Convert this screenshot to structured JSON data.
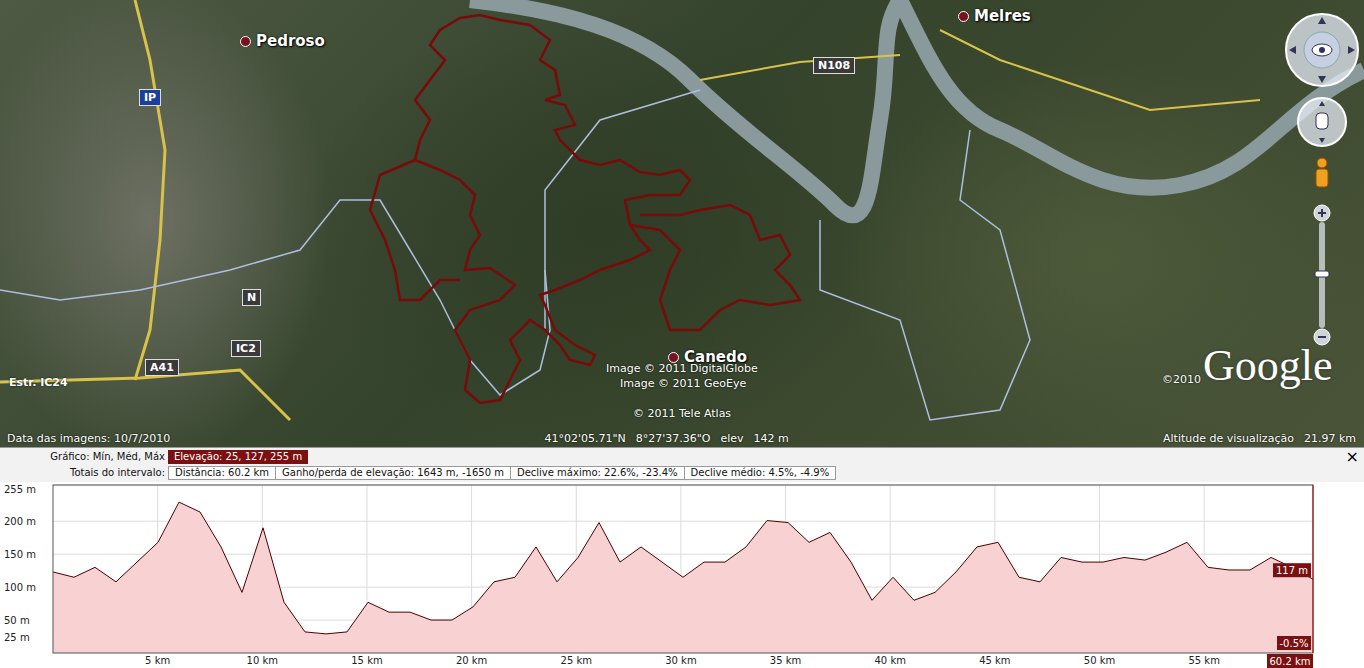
{
  "map": {
    "places": [
      {
        "name": "Pedroso"
      },
      {
        "name": "Melres"
      },
      {
        "name": "Canedo"
      }
    ],
    "road_shields": [
      {
        "label": "IP",
        "kind": "highway"
      },
      {
        "label": "N108",
        "kind": "road"
      },
      {
        "label": "N",
        "kind": "road"
      },
      {
        "label": "IC2",
        "kind": "road"
      },
      {
        "label": "A41",
        "kind": "road"
      },
      {
        "label": "Estr. IC24",
        "kind": "plain"
      }
    ],
    "credits": [
      "Image © 2011 DigitalGlobe",
      "Image © 2011 GeoEye",
      "© 2011 Tele Atlas"
    ],
    "logo": "Google",
    "logo_copyright": "©2010"
  },
  "status_bar": {
    "imagery_date": "Data das imagens: 10/7/2010",
    "latitude": "41°02'05.71\"N",
    "longitude": "8°27'37.36\"O",
    "elevation_label": "elev",
    "elevation": "142 m",
    "eye_altitude_label": "Altitude de visualização",
    "eye_altitude": "21.97 km"
  },
  "profile": {
    "graph_label": "Gráfico: Mín, Méd, Máx",
    "graph_value": "Elevação: 25, 127, 255 m",
    "totals_label": "Totais do intervalo:",
    "totals": [
      "Distância: 60.2 km",
      "Ganho/perda de elevação: 1643 m, -1650 m",
      "Declive máximo: 22.6%, -23.4%",
      "Declive médio: 4.5%, -4.9%"
    ],
    "close": "×",
    "y_ticks": [
      "255 m",
      "200 m",
      "150 m",
      "100 m",
      "50 m",
      "25 m"
    ],
    "x_ticks": [
      "5 km",
      "10 km",
      "15 km",
      "20 km",
      "25 km",
      "30 km",
      "35 km",
      "40 km",
      "45 km",
      "50 km",
      "55 km"
    ],
    "x_end": "60.2 km",
    "cursor_elevation": "117 m",
    "cursor_slope": "-0.5%",
    "series": [
      {
        "name": "Elevação",
        "values": [
          123,
          115,
          130,
          108,
          138,
          168,
          229,
          214,
          161,
          92,
          190,
          77,
          32,
          29,
          32,
          77,
          62,
          62,
          50,
          50,
          70,
          108,
          115,
          161,
          108,
          145,
          198,
          138,
          161,
          138,
          115,
          138,
          138,
          161,
          201,
          198,
          168,
          183,
          138,
          80,
          115,
          80,
          92,
          123,
          161,
          168,
          115,
          108,
          145,
          138,
          138,
          145,
          141,
          153,
          168,
          130,
          126,
          126,
          145,
          130,
          112
        ]
      }
    ]
  }
}
